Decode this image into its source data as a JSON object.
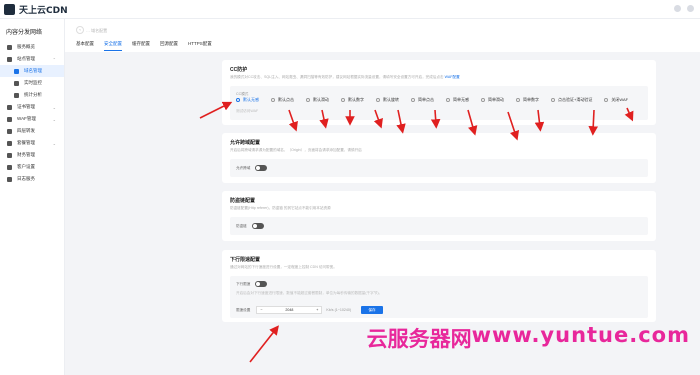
{
  "app": {
    "title": "天上云CDN"
  },
  "sidebar": {
    "title": "内容分发网络",
    "items": [
      {
        "label": "服务概览",
        "type": "top"
      },
      {
        "label": "站点管理",
        "type": "group"
      },
      {
        "label": "域名管理",
        "type": "sub",
        "active": true
      },
      {
        "label": "实时监控",
        "type": "sub"
      },
      {
        "label": "统计分析",
        "type": "sub"
      },
      {
        "label": "证书管理",
        "type": "group"
      },
      {
        "label": "WAF管理",
        "type": "group"
      },
      {
        "label": "四层转发",
        "type": "group"
      },
      {
        "label": "套餐管理",
        "type": "group"
      },
      {
        "label": "财务管理",
        "type": "top"
      },
      {
        "label": "客户设置",
        "type": "top"
      },
      {
        "label": "日志服务",
        "type": "top"
      }
    ]
  },
  "header": {
    "domain": "… 域名配置",
    "tabs": [
      {
        "label": "基本配置"
      },
      {
        "label": "安全配置",
        "active": true
      },
      {
        "label": "缓存配置"
      },
      {
        "label": "回源配置"
      },
      {
        "label": "HTTPS配置"
      }
    ]
  },
  "cc": {
    "title": "CC防护",
    "desc": "我的模式对CC攻击、SQL注入、网站爬虫、漏洞扫描等有效防护，建议网站根据实际流量设置，请填写安全设置方可开启，完成后点击",
    "link": "WAF配置",
    "mode_label": "CC模式",
    "options": [
      "默认无感",
      "默认点击",
      "默认滑动",
      "默认数字",
      "默认旋转",
      "简单点击",
      "简单无感",
      "简单滑动",
      "简单数字",
      "点击验证+滑动验证",
      "关闭WAF"
    ],
    "selected": 0,
    "hint": "测试访问WAF"
  },
  "referer": {
    "title": "允许跨域配置",
    "desc": "开启后将跨域请求源为配置的域名，（Origin），页面将会请求添加配置，请慎开启",
    "toggle_label": "允许跨域"
  },
  "anti_hotlink": {
    "title": "防盗链配置",
    "desc": "防盗链配置(Http referer)，防盗链 的其它站点不能引用本站资源",
    "toggle_label": "防盗链"
  },
  "rate_limit": {
    "title": "下行限速配置",
    "desc": "通过对网站的下行速度进行设置，一定程度上控制 CDN 访问带宽。",
    "toggle_label": "下行限速",
    "toggle_hint": "开启后会对下行速度进行限速，数值不能超过套餐限制，单位为每秒传输的数据量(千字节)。",
    "field_label": "限速设置",
    "value": "2048",
    "unit": "Kb/s (1~10240)",
    "save": "保存"
  },
  "watermark": {
    "part1": "云服务器网",
    "part2": "www.yuntue.com"
  }
}
